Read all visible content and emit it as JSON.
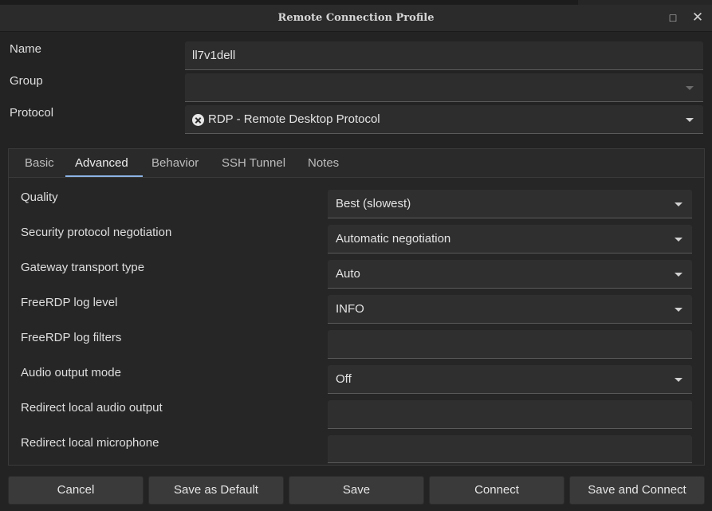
{
  "window": {
    "title": "Remote Connection Profile"
  },
  "form": {
    "name_label": "Name",
    "name_value": "ll7v1dell",
    "group_label": "Group",
    "group_value": "",
    "protocol_label": "Protocol",
    "protocol_value": "RDP - Remote Desktop Protocol"
  },
  "tabs": [
    {
      "label": "Basic",
      "active": false
    },
    {
      "label": "Advanced",
      "active": true
    },
    {
      "label": "Behavior",
      "active": false
    },
    {
      "label": "SSH Tunnel",
      "active": false
    },
    {
      "label": "Notes",
      "active": false
    }
  ],
  "advanced": [
    {
      "label": "Quality",
      "value": "Best (slowest)",
      "type": "select"
    },
    {
      "label": "Security protocol negotiation",
      "value": "Automatic negotiation",
      "type": "select"
    },
    {
      "label": "Gateway transport type",
      "value": "Auto",
      "type": "select"
    },
    {
      "label": "FreeRDP log level",
      "value": "INFO",
      "type": "select"
    },
    {
      "label": "FreeRDP log filters",
      "value": "",
      "type": "text"
    },
    {
      "label": "Audio output mode",
      "value": "Off",
      "type": "select"
    },
    {
      "label": "Redirect local audio output",
      "value": "",
      "type": "text"
    },
    {
      "label": "Redirect local microphone",
      "value": "",
      "type": "text"
    }
  ],
  "buttons": {
    "cancel": "Cancel",
    "save_default": "Save as Default",
    "save": "Save",
    "connect": "Connect",
    "save_connect": "Save and Connect"
  },
  "icons": {
    "maximize": "maximize-icon",
    "close": "close-icon",
    "protocol": "rdp-icon",
    "dropdown": "chevron-down-icon"
  }
}
